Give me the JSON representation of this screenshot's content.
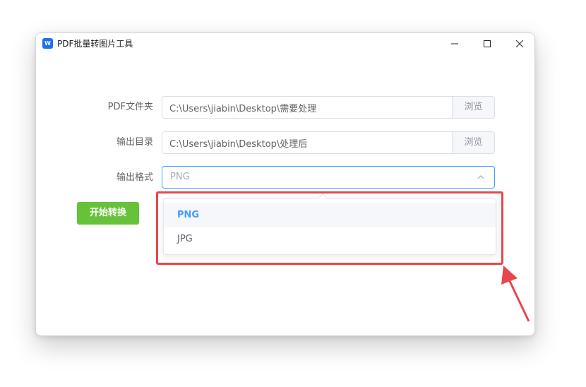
{
  "window": {
    "title": "PDF批量转图片工具",
    "icon_letter": "W",
    "controls": [
      "minimize-icon",
      "maximize-icon",
      "close-icon"
    ]
  },
  "form": {
    "pdf_folder_label": "PDF文件夹",
    "pdf_folder_value": "C:\\Users\\jiabin\\Desktop\\需要处理",
    "output_dir_label": "输出目录",
    "output_dir_value": "C:\\Users\\jiabin\\Desktop\\处理后",
    "browse_label": "浏览",
    "format_label": "输出格式",
    "format_selected": "PNG",
    "start_label": "开始转换"
  },
  "dropdown": {
    "options": [
      "PNG",
      "JPG"
    ],
    "active": "PNG"
  },
  "colors": {
    "accent": "#409eff",
    "success": "#67c23a",
    "annotation": "#e6474d",
    "app_icon": "#1e6ff1"
  }
}
